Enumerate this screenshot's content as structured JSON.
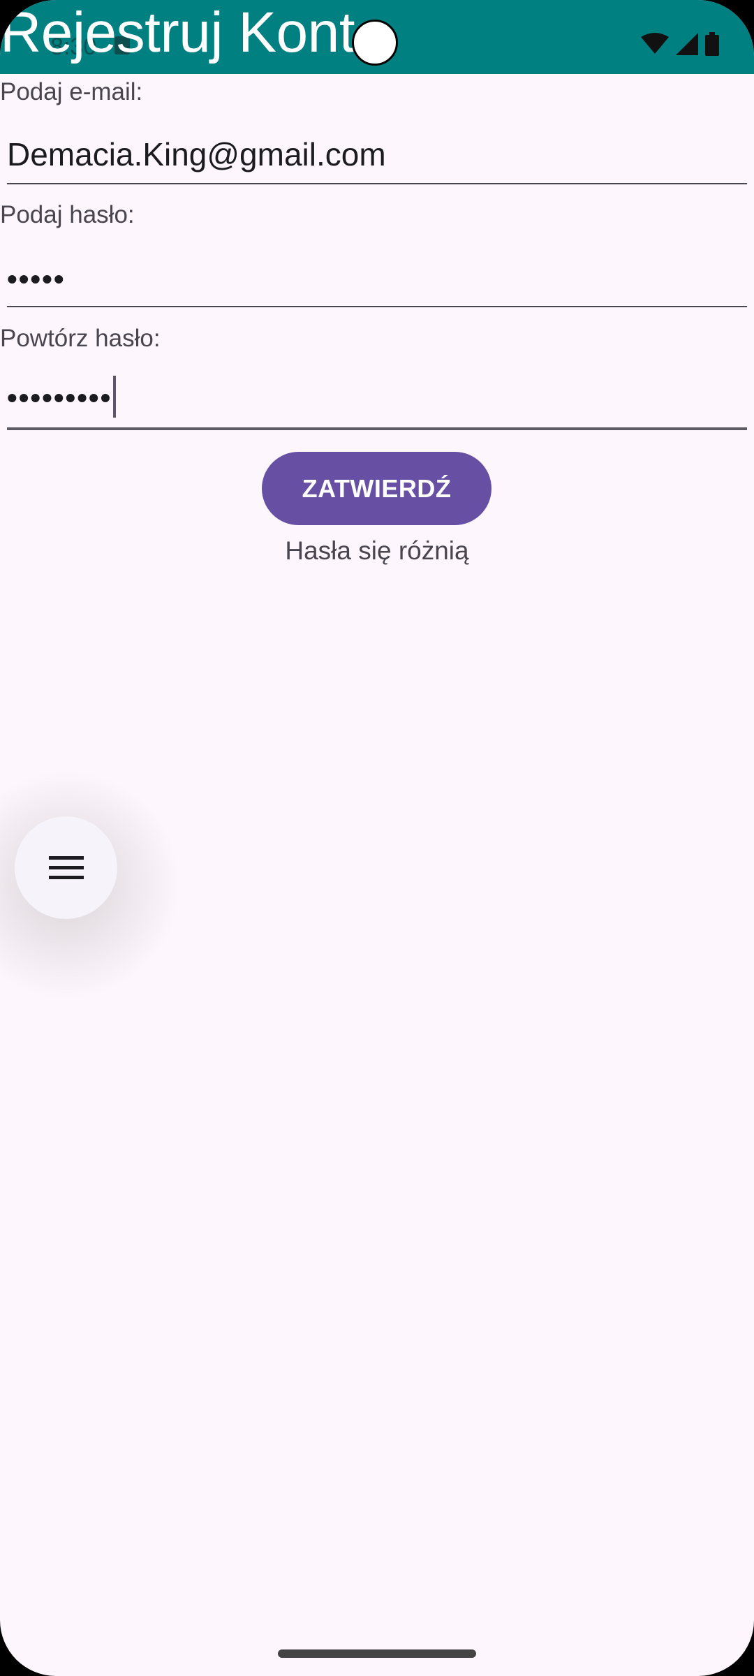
{
  "app_bar": {
    "title": "Rejestruj Konto",
    "color": "#008080"
  },
  "status_bar": {
    "time": "8:30"
  },
  "form": {
    "email_label": "Podaj e-mail:",
    "email_value": "Demacia.King@gmail.com",
    "password_label": "Podaj hasło:",
    "password_value": "•••••",
    "repeat_label": "Powtórz hasło:",
    "repeat_value": "•••••••••",
    "submit_label": "ZATWIERDŹ",
    "error_text": "Hasła się różnią"
  },
  "fab": {
    "icon": "menu-icon"
  },
  "colors": {
    "background": "#FDF6FC",
    "button": "#6750A4",
    "text": "#49454F"
  }
}
